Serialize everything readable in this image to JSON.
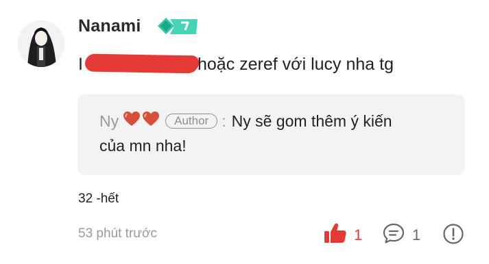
{
  "comment": {
    "username": "Nanami",
    "level_badge": "7",
    "text_lead": "I",
    "text_rest": "hoặc zeref với lucy nha tg",
    "redaction_color": "#e53935"
  },
  "reply": {
    "name": "Ny",
    "hearts": [
      "heart-icon",
      "heart-icon"
    ],
    "author_label": "Author",
    "separator": ":",
    "text_line1": "Ny sẽ gom thêm ý kiến",
    "text_line2": "của mn nha!"
  },
  "footer_note": "32 -hết",
  "timestamp": "53 phút trước",
  "actions": {
    "like_count": "1",
    "comment_count": "1",
    "like_color": "#e53935"
  },
  "icons": {
    "like": "thumbs-up-icon",
    "comment": "comment-bubble-icon",
    "report": "info-circle-icon",
    "badge": "level-badge-icon"
  }
}
